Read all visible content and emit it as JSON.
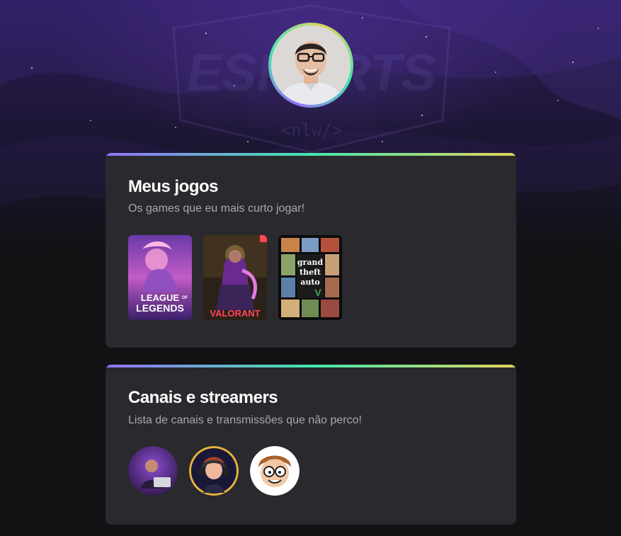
{
  "profile": {
    "avatar_alt": "Foto de perfil"
  },
  "hero": {
    "background_logo_text": "ESPORTS",
    "background_tag_text": "<nlw/>"
  },
  "games_section": {
    "title": "Meus jogos",
    "subtitle": "Os games que eu mais curto jogar!",
    "games": [
      {
        "name": "League of Legends",
        "cover_line1": "LEAGUE",
        "cover_of": "OF",
        "cover_line2": "LEGENDS"
      },
      {
        "name": "Valorant",
        "cover_text": "VALORANT"
      },
      {
        "name": "Grand Theft Auto V",
        "cover_line1": "grand",
        "cover_line2": "theft",
        "cover_line3": "auto",
        "cover_v": "V"
      }
    ]
  },
  "channels_section": {
    "title": "Canais e streamers",
    "subtitle": "Lista de canais e transmissões que não perco!",
    "channels": [
      {
        "name": "channel-1"
      },
      {
        "name": "channel-2"
      },
      {
        "name": "channel-3"
      }
    ]
  },
  "colors": {
    "background": "#121214",
    "card": "#29292e",
    "gradient_start": "#9572fc",
    "gradient_mid": "#43e7ad",
    "gradient_end": "#e2d45c",
    "subtitle": "#a8a8b3"
  }
}
